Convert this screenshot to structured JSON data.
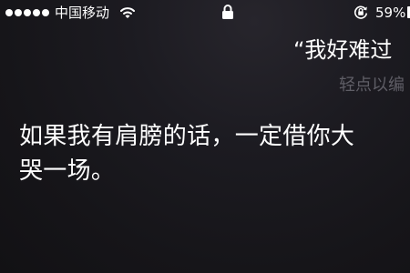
{
  "status_bar": {
    "signal_dots": 5,
    "carrier": "中国移动",
    "battery_percent": "59%"
  },
  "conversation": {
    "user_quote": "“我好难过",
    "tap_hint": "轻点以编",
    "siri_response": "如果我有肩膀的话，一定借你大哭一场。"
  },
  "colors": {
    "background": "#1c1b21",
    "text": "#ffffff",
    "hint": "#5f5e66"
  },
  "icons": [
    "wifi-icon",
    "lock-icon",
    "rotation-lock-icon",
    "battery-icon"
  ]
}
